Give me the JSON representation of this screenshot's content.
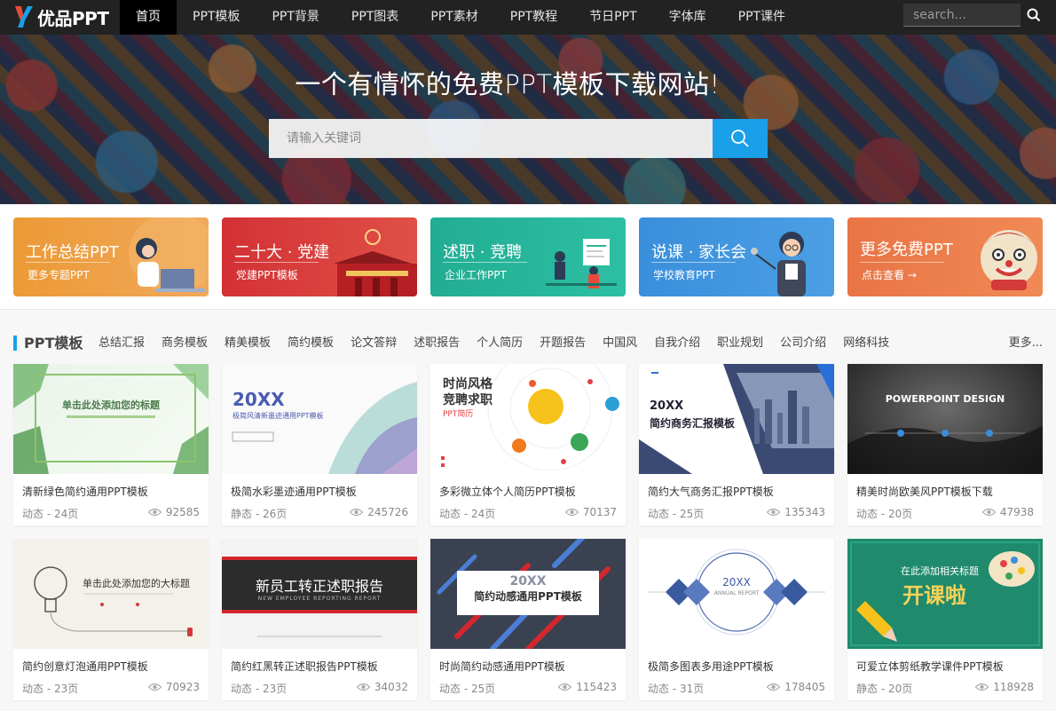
{
  "nav": {
    "logo_text": "优品PPT",
    "items": [
      {
        "label": "首页",
        "active": true
      },
      {
        "label": "PPT模板"
      },
      {
        "label": "PPT背景"
      },
      {
        "label": "PPT图表"
      },
      {
        "label": "PPT素材"
      },
      {
        "label": "PPT教程"
      },
      {
        "label": "节日PPT"
      },
      {
        "label": "字体库"
      },
      {
        "label": "PPT课件"
      }
    ],
    "search_placeholder": "search..."
  },
  "banner": {
    "title": "一个有情怀的免费PPT模板下载网站!",
    "search_placeholder": "请输入关键词"
  },
  "promos": [
    {
      "title": "工作总结PPT",
      "sub": "更多专题PPT",
      "color": "#e9953a"
    },
    {
      "title": "二十大 · 党建",
      "sub": "党建PPT模板",
      "color": "#d7373b"
    },
    {
      "title": "述职 · 竞聘",
      "sub": "企业工作PPT",
      "color": "#27b39a"
    },
    {
      "title": "说课 · 家长会",
      "sub": "学校教育PPT",
      "color": "#3b8ed8"
    },
    {
      "title": "更多免费PPT",
      "sub": "点击查看 →",
      "color": "#ea7a4a"
    }
  ],
  "section": {
    "title": "PPT模板",
    "tags": [
      "总结汇报",
      "商务模板",
      "精美模板",
      "简约模板",
      "论文答辩",
      "述职报告",
      "个人简历",
      "开题报告",
      "中国风",
      "自我介绍",
      "职业规划",
      "公司介绍",
      "网络科技"
    ],
    "more": "更多..."
  },
  "cards": [
    {
      "title": "清新绿色简约通用PPT模板",
      "meta": "动态 - 24页",
      "views": "92585",
      "thumb_text": "单击此处添加您的标题"
    },
    {
      "title": "极简水彩墨迹通用PPT模板",
      "meta": "静态 - 26页",
      "views": "245726",
      "thumb_text": "20XX",
      "thumb_sub": "极简风清新墨迹通用PPT模板"
    },
    {
      "title": "多彩微立体个人简历PPT模板",
      "meta": "动态 - 24页",
      "views": "70137",
      "thumb_text": "时尚风格",
      "thumb_text2": "竞聘求职",
      "thumb_sub": "PPT简历"
    },
    {
      "title": "简约大气商务汇报PPT模板",
      "meta": "动态 - 25页",
      "views": "135343",
      "thumb_text": "20XX",
      "thumb_sub": "简约商务汇报模板"
    },
    {
      "title": "精美时尚欧美风PPT模板下载",
      "meta": "动态 - 20页",
      "views": "47938",
      "thumb_text": "POWERPOINT DESIGN"
    },
    {
      "title": "简约创意灯泡通用PPT模板",
      "meta": "动态 - 23页",
      "views": "70923",
      "thumb_text": "单击此处添加您的大标题"
    },
    {
      "title": "简约红黑转正述职报告PPT模板",
      "meta": "动态 - 23页",
      "views": "34032",
      "thumb_text": "新员工转正述职报告",
      "thumb_sub": "NEW EMPLOYEE REPORTING REPORT"
    },
    {
      "title": "时尚简约动感通用PPT模板",
      "meta": "动态 - 25页",
      "views": "115423",
      "thumb_text": "20XX",
      "thumb_sub": "简约动感通用PPT模板"
    },
    {
      "title": "极简多图表多用途PPT模板",
      "meta": "动态 - 31页",
      "views": "178405",
      "thumb_text": "20XX",
      "thumb_sub": "ANNUAL REPORT"
    },
    {
      "title": "可爱立体剪纸教学课件PPT模板",
      "meta": "静态 - 20页",
      "views": "118928",
      "thumb_text": "在此添加相关标题",
      "thumb_sub": "开课啦"
    }
  ]
}
